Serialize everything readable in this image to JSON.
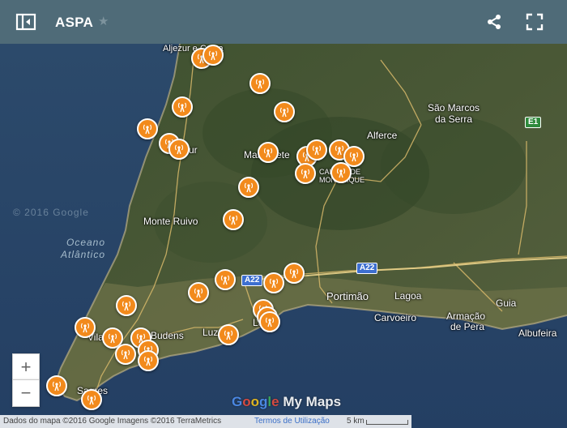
{
  "header": {
    "title": "ASPA",
    "icons": [
      "sidebar-toggle-icon",
      "star-icon",
      "share-icon",
      "fullscreen-icon"
    ],
    "background": "#4f6b78"
  },
  "map": {
    "labels": {
      "sao_marcos": "São Marcos",
      "da_serra": "da Serra",
      "alferce": "Alferce",
      "monte_ruivo": "Monte Ruivo",
      "portimao": "Portimão",
      "lagoa": "Lagoa",
      "carvoeiro": "Carvoeiro",
      "armacao": "Armação",
      "de_pera": "de Pera",
      "guia": "Guia",
      "albufeira": "Albufeira",
      "budens": "Budens",
      "luz": "Luz",
      "lagos": "Lagos",
      "vila": "Vila",
      "sagres": "Sagres",
      "aljezur": "ur",
      "marmelete": "Marmelete",
      "monchique_1": "CALDAS DE",
      "monchique_2": "MONCHIQUE",
      "ocean_1": "Oceano",
      "ocean_2": "Atlântico",
      "rogil": "Aljezur e Costa"
    },
    "road_signs": [
      "A22",
      "A22",
      "E1"
    ],
    "watermarks": [
      "© 2016 Google"
    ],
    "marker_color": "#f28a1c",
    "marker_icon": "radio-tower-icon",
    "marker_count": 34
  },
  "controls": {
    "zoom_in": "+",
    "zoom_out": "−"
  },
  "brand": {
    "text": "Google My Maps"
  },
  "attribution": {
    "data": "Dados do mapa ©2016 Google Imagens ©2016 TerraMetrics",
    "terms": "Termos de Utilização",
    "scale": "5 km"
  }
}
